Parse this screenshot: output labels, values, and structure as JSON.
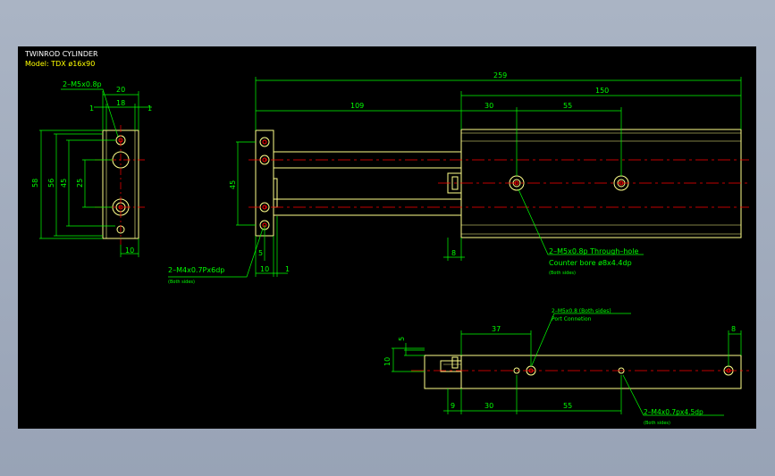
{
  "title": {
    "line1": "TWINROD CYLINDER",
    "line2": "Model: TDX  ø16x90"
  },
  "colors": {
    "bg": "#000000",
    "yellow": "#ffff00",
    "green": "#00ff00",
    "red": "#ff0000",
    "white": "#ffffff",
    "part": "#ffff8a"
  },
  "end_view": {
    "callout": "2–M5x0.8p",
    "dims": {
      "width": "20",
      "left": "1",
      "inner": "18",
      "right": "1",
      "h58": "58",
      "h56": "56",
      "h45": "45",
      "h25": "25",
      "bottom": "10"
    }
  },
  "front_view": {
    "dims": {
      "total": "259",
      "stroke_len": "150",
      "to_body": "109",
      "d30": "30",
      "d55": "55",
      "h45": "45",
      "b5": "5",
      "b10": "10",
      "b1": "1",
      "b8": "8"
    },
    "callout_left": "2–M4x0.7Px6dp",
    "callout_left_note": "(Both sides)",
    "callout_right": "2–M5x0.8p Through–hole",
    "callout_right_2": "Counter bore ø8x4.4dp",
    "callout_right_note": "(Both sides)"
  },
  "bottom_view": {
    "dims": {
      "d37": "37",
      "d8": "8",
      "v5": "5",
      "v10": "10",
      "b9": "9",
      "b30": "30",
      "b55": "55"
    },
    "callout_top": "2–M5x0.8 (Both sides)",
    "callout_top_2": "Port Connetion",
    "callout_bottom": "2–M4x0.7px4.5dp",
    "callout_bottom_note": "(Both sides)"
  }
}
